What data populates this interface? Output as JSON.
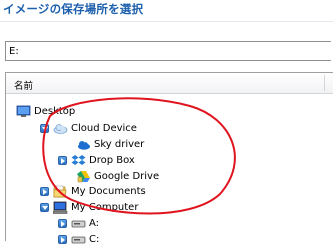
{
  "title": "イメージの保存場所を選択",
  "path": {
    "value": "E:"
  },
  "column_header": "名前",
  "tree": {
    "desktop": "Desktop",
    "cloud_device": "Cloud Device",
    "sky_driver": "Sky driver",
    "drop_box": "Drop Box",
    "google_drive": "Google Drive",
    "my_documents": "My Documents",
    "my_computer": "My Computer",
    "drive_a": "A:",
    "drive_c": "C:"
  },
  "colors": {
    "title": "#1c5fad",
    "annotation": "#e0141e"
  }
}
